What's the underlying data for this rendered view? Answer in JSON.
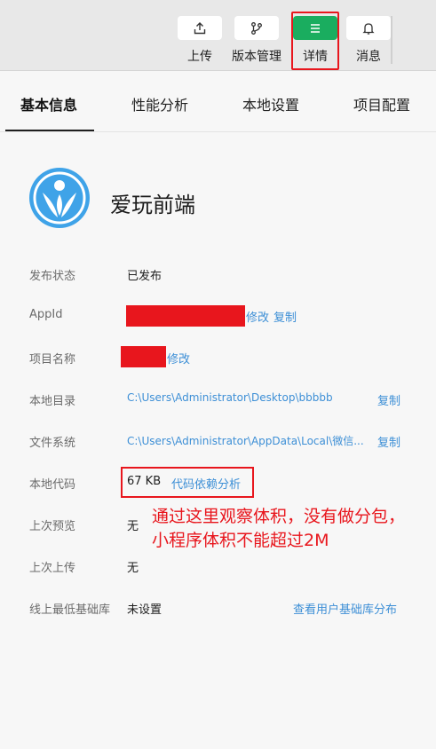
{
  "toolbar": {
    "upload_label": "上传",
    "version_label": "版本管理",
    "details_label": "详情",
    "messages_label": "消息",
    "active_color": "#1aad5f"
  },
  "tabs": [
    "基本信息",
    "性能分析",
    "本地设置",
    "项目配置"
  ],
  "app": {
    "name": "爱玩前端"
  },
  "rows": {
    "publish_status": {
      "label": "发布状态",
      "value": "已发布"
    },
    "appid": {
      "label": "AppId",
      "modify": "修改",
      "copy": "复制"
    },
    "project_name": {
      "label": "项目名称",
      "modify": "修改"
    },
    "local_dir": {
      "label": "本地目录",
      "value": "C:\\Users\\Administrator\\Desktop\\bbbbb",
      "copy": "复制"
    },
    "file_system": {
      "label": "文件系统",
      "value": "C:\\Users\\Administrator\\AppData\\Local\\微信...",
      "copy": "复制"
    },
    "local_code": {
      "label": "本地代码",
      "value": "67 KB",
      "link": "代码依赖分析"
    },
    "last_preview": {
      "label": "上次预览",
      "value": "无"
    },
    "last_upload": {
      "label": "上次上传",
      "value": "无"
    },
    "min_base_lib": {
      "label": "线上最低基础库",
      "value": "未设置",
      "link": "查看用户基础库分布"
    }
  },
  "annotation": {
    "line1": "通过这里观察体积，没有做分包，",
    "line2": "小程序体积不能超过2M",
    "color": "#e8161d"
  }
}
